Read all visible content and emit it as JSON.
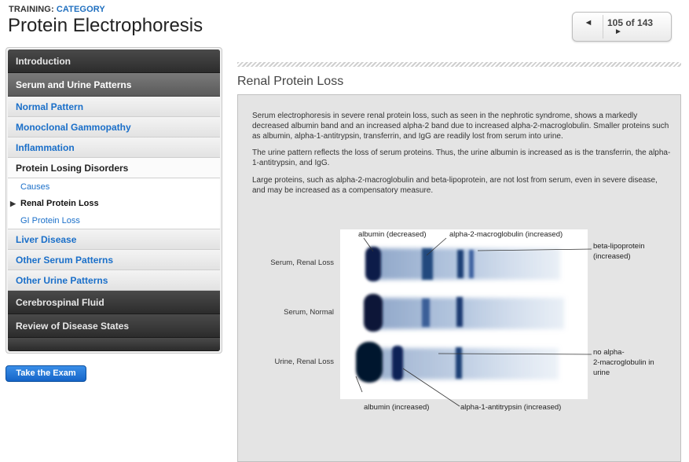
{
  "header": {
    "kicker_prefix": "TRAINING: ",
    "kicker_category": "CATEGORY",
    "title": "Protein Electrophoresis"
  },
  "pager": {
    "prev_icon": "◄",
    "next_icon": "►",
    "count": "105 of 143"
  },
  "sidebar": {
    "items": [
      {
        "label": "Introduction"
      },
      {
        "label": "Serum and Urine Patterns"
      },
      {
        "label": "Normal Pattern"
      },
      {
        "label": "Monoclonal Gammopathy"
      },
      {
        "label": "Inflammation"
      },
      {
        "label": "Protein Losing Disorders"
      },
      {
        "label": "Causes"
      },
      {
        "label": "Renal Protein Loss"
      },
      {
        "label": "GI Protein Loss"
      },
      {
        "label": "Liver Disease"
      },
      {
        "label": "Other Serum Patterns"
      },
      {
        "label": "Other Urine Patterns"
      },
      {
        "label": "Cerebrospinal Fluid"
      },
      {
        "label": "Review of Disease States"
      }
    ],
    "active_marker": "▶"
  },
  "exam_button": {
    "label": "Take the Exam"
  },
  "content": {
    "section_title": "Renal Protein Loss",
    "paragraphs": [
      "Serum electrophoresis in severe renal protein loss, such as seen in the nephrotic syndrome, shows a markedly decreased albumin band and an increased alpha-2 band due to increased alpha-2-macroglobulin. Smaller proteins such as albumin, alpha-1-antitrypsin, transferrin, and IgG are readily lost from serum into urine.",
      "The urine pattern reflects the loss of serum proteins. Thus, the urine albumin is increased as is the transferrin, the alpha-1-antitrypsin, and IgG.",
      "Large proteins, such as alpha-2-macroglobulin and beta-lipoprotein, are not lost from serum, even in severe disease, and may be increased as a compensatory measure."
    ]
  },
  "figure": {
    "row_labels": [
      "Serum, Renal Loss",
      "Serum, Normal",
      "Urine, Renal Loss"
    ],
    "annotations": {
      "albumin_decreased": "albumin (decreased)",
      "a2m_increased": "alpha-2-macroglobulin (increased)",
      "beta_lipo_line1": "beta-lipoprotein",
      "beta_lipo_line2": "(increased)",
      "no_a2m_line1": "no alpha-",
      "no_a2m_line2": "2-macroglobulin in",
      "no_a2m_line3": "urine",
      "albumin_increased": "albumin (increased)",
      "a1at_increased": "alpha-1-antitrypsin (increased)"
    }
  }
}
